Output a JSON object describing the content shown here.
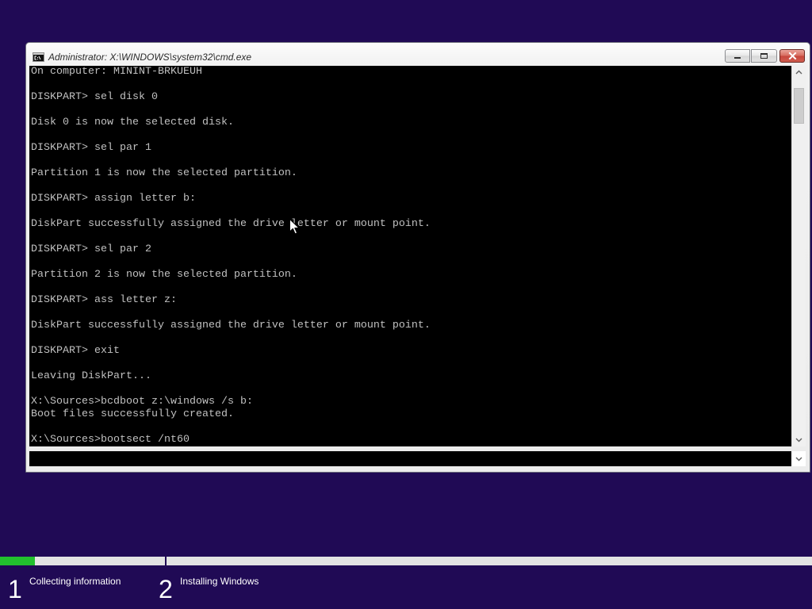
{
  "window": {
    "title": "Administrator: X:\\WINDOWS\\system32\\cmd.exe",
    "icon": "cmd-icon",
    "buttons": {
      "minimize": "minimize-icon",
      "maximize": "maximize-icon",
      "close": "close-icon"
    }
  },
  "console": {
    "lines": [
      "On computer: MININT-BRKUEUH",
      "",
      "DISKPART> sel disk 0",
      "",
      "Disk 0 is now the selected disk.",
      "",
      "DISKPART> sel par 1",
      "",
      "Partition 1 is now the selected partition.",
      "",
      "DISKPART> assign letter b:",
      "",
      "DiskPart successfully assigned the drive letter or mount point.",
      "",
      "DISKPART> sel par 2",
      "",
      "Partition 2 is now the selected partition.",
      "",
      "DISKPART> ass letter z:",
      "",
      "DiskPart successfully assigned the drive letter or mount point.",
      "",
      "DISKPART> exit",
      "",
      "Leaving DiskPart...",
      "",
      "X:\\Sources>bcdboot z:\\windows /s b:",
      "Boot files successfully created.",
      "",
      "X:\\Sources>bootsect /nt60"
    ],
    "scrollbar": {
      "position": 0.03,
      "visible_fraction": 0.1,
      "up_icon": "chevron-up-icon",
      "down_icon": "chevron-down-icon"
    }
  },
  "cursor": "arrow-cursor-icon",
  "setup": {
    "steps": [
      {
        "number": "1",
        "label": "Collecting information",
        "progress": 0.21
      },
      {
        "number": "2",
        "label": "Installing Windows",
        "progress": 0
      }
    ]
  },
  "colors": {
    "desktop_background": "#200a55",
    "console_background": "#000000",
    "console_text": "#c0c0c0",
    "progress_fill": "#22c02e",
    "progress_track": "#e3e3e3",
    "close_button": "#c7463c"
  }
}
